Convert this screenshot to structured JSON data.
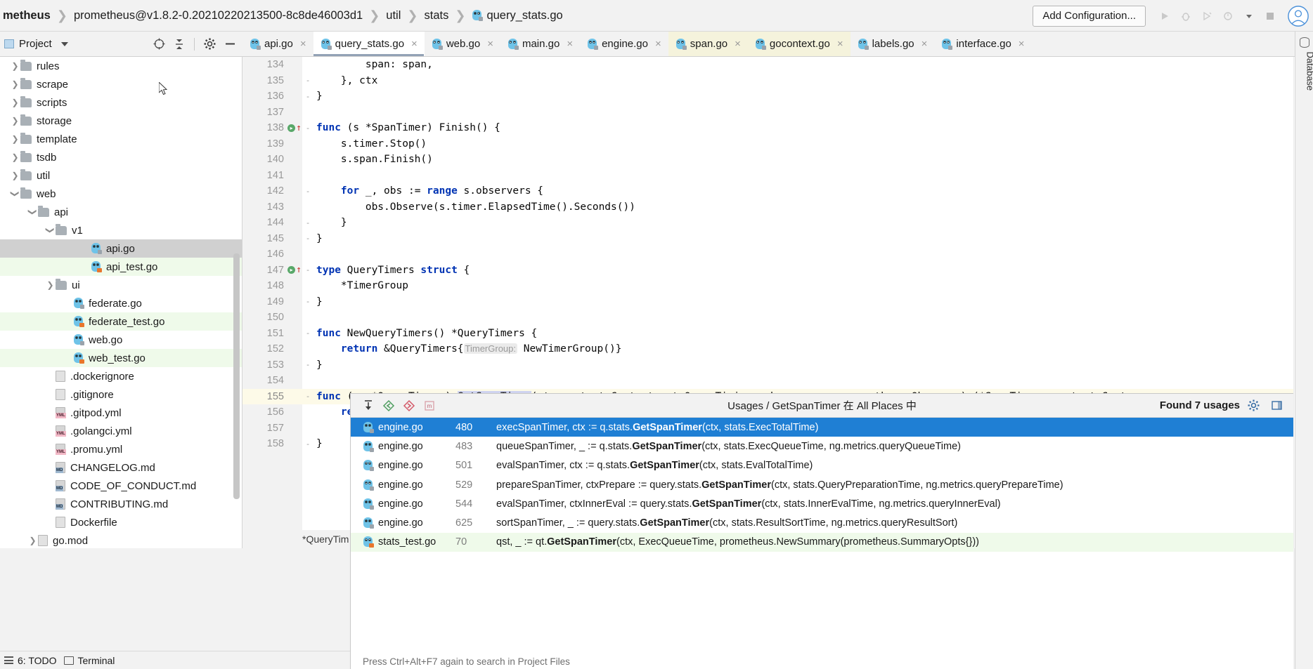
{
  "window": {
    "breadcrumbs": [
      {
        "label": "metheus",
        "bold": true,
        "icon": null
      },
      {
        "label": "prometheus@v1.8.2-0.20210220213500-8c8de46003d1",
        "bold": false,
        "icon": null
      },
      {
        "label": "util",
        "bold": false,
        "icon": null
      },
      {
        "label": "stats",
        "bold": false,
        "icon": null
      },
      {
        "label": "query_stats.go",
        "bold": false,
        "icon": "go-file-icon"
      }
    ],
    "add_configuration_label": "Add Configuration...",
    "toolbar_icons": [
      "run-icon",
      "debug-icon",
      "run-with-coverage-icon",
      "profile-icon",
      "chevron-down-icon",
      "stop-icon"
    ],
    "avatar": "user-avatar"
  },
  "project_panel": {
    "title": "Project",
    "icons": [
      "locate-icon",
      "collapse-all-icon",
      "settings-gear-icon",
      "hide-icon"
    ]
  },
  "tabs": [
    {
      "label": "api.go",
      "state": "normal",
      "icon": "go-file-icon"
    },
    {
      "label": "query_stats.go",
      "state": "active",
      "icon": "go-file-icon"
    },
    {
      "label": "web.go",
      "state": "normal",
      "icon": "go-file-icon"
    },
    {
      "label": "main.go",
      "state": "normal",
      "icon": "go-file-icon"
    },
    {
      "label": "engine.go",
      "state": "normal",
      "icon": "go-file-icon"
    },
    {
      "label": "span.go",
      "state": "modified",
      "icon": "go-file-icon"
    },
    {
      "label": "gocontext.go",
      "state": "modified",
      "icon": "go-file-icon"
    },
    {
      "label": "labels.go",
      "state": "normal",
      "icon": "go-file-icon"
    },
    {
      "label": "interface.go",
      "state": "normal",
      "icon": "go-file-icon"
    }
  ],
  "tree": [
    {
      "label": "rules",
      "indent": 1,
      "type": "folder",
      "arrow": "collapsed",
      "bg": "none"
    },
    {
      "label": "scrape",
      "indent": 1,
      "type": "folder",
      "arrow": "collapsed",
      "bg": "none"
    },
    {
      "label": "scripts",
      "indent": 1,
      "type": "folder",
      "arrow": "collapsed",
      "bg": "none"
    },
    {
      "label": "storage",
      "indent": 1,
      "type": "folder",
      "arrow": "collapsed",
      "bg": "none"
    },
    {
      "label": "template",
      "indent": 1,
      "type": "folder",
      "arrow": "collapsed",
      "bg": "none"
    },
    {
      "label": "tsdb",
      "indent": 1,
      "type": "folder",
      "arrow": "collapsed",
      "bg": "none"
    },
    {
      "label": "util",
      "indent": 1,
      "type": "folder",
      "arrow": "collapsed",
      "bg": "none"
    },
    {
      "label": "web",
      "indent": 1,
      "type": "folder",
      "arrow": "expanded",
      "bg": "none"
    },
    {
      "label": "api",
      "indent": 2,
      "type": "folder",
      "arrow": "expanded",
      "bg": "none"
    },
    {
      "label": "v1",
      "indent": 3,
      "type": "folder",
      "arrow": "expanded",
      "bg": "none"
    },
    {
      "label": "api.go",
      "indent": 5,
      "type": "go",
      "arrow": "none",
      "bg": "selected"
    },
    {
      "label": "api_test.go",
      "indent": 5,
      "type": "gotest",
      "arrow": "none",
      "bg": "green"
    },
    {
      "label": "ui",
      "indent": 3,
      "type": "folder",
      "arrow": "collapsed",
      "bg": "none"
    },
    {
      "label": "federate.go",
      "indent": 4,
      "type": "go",
      "arrow": "none",
      "bg": "none"
    },
    {
      "label": "federate_test.go",
      "indent": 4,
      "type": "gotest",
      "arrow": "none",
      "bg": "green"
    },
    {
      "label": "web.go",
      "indent": 4,
      "type": "go",
      "arrow": "none",
      "bg": "none"
    },
    {
      "label": "web_test.go",
      "indent": 4,
      "type": "gotest",
      "arrow": "none",
      "bg": "green"
    },
    {
      "label": ".dockerignore",
      "indent": 3,
      "type": "doc",
      "arrow": "none",
      "bg": "none"
    },
    {
      "label": ".gitignore",
      "indent": 3,
      "type": "doc",
      "arrow": "none",
      "bg": "none"
    },
    {
      "label": ".gitpod.yml",
      "indent": 3,
      "type": "yml",
      "arrow": "none",
      "bg": "none"
    },
    {
      "label": ".golangci.yml",
      "indent": 3,
      "type": "yml",
      "arrow": "none",
      "bg": "none"
    },
    {
      "label": ".promu.yml",
      "indent": 3,
      "type": "yml",
      "arrow": "none",
      "bg": "none"
    },
    {
      "label": "CHANGELOG.md",
      "indent": 3,
      "type": "md",
      "arrow": "none",
      "bg": "none"
    },
    {
      "label": "CODE_OF_CONDUCT.md",
      "indent": 3,
      "type": "md",
      "arrow": "none",
      "bg": "none"
    },
    {
      "label": "CONTRIBUTING.md",
      "indent": 3,
      "type": "md",
      "arrow": "none",
      "bg": "none"
    },
    {
      "label": "Dockerfile",
      "indent": 3,
      "type": "doc",
      "arrow": "none",
      "bg": "none"
    },
    {
      "label": "go.mod",
      "indent": 2,
      "type": "doc",
      "arrow": "collapsed",
      "bg": "none"
    }
  ],
  "code": {
    "file_status": "*QueryTim",
    "lines": [
      {
        "num": "134",
        "mark": "",
        "fold": "",
        "caret": false,
        "segs": [
          {
            "t": "        span: span,",
            "c": "plain"
          }
        ]
      },
      {
        "num": "135",
        "mark": "",
        "fold": "-",
        "caret": false,
        "segs": [
          {
            "t": "    }, ctx",
            "c": "plain"
          }
        ]
      },
      {
        "num": "136",
        "mark": "",
        "fold": "-",
        "caret": false,
        "segs": [
          {
            "t": "}",
            "c": "plain"
          }
        ]
      },
      {
        "num": "137",
        "mark": "",
        "fold": "",
        "caret": false,
        "segs": []
      },
      {
        "num": "138",
        "mark": "run",
        "fold": "-",
        "caret": false,
        "segs": [
          {
            "t": "func",
            "c": "kw"
          },
          {
            "t": " (s *SpanTimer) Finish() {",
            "c": "plain"
          }
        ]
      },
      {
        "num": "139",
        "mark": "",
        "fold": "",
        "caret": false,
        "segs": [
          {
            "t": "    s.timer.Stop()",
            "c": "plain"
          }
        ]
      },
      {
        "num": "140",
        "mark": "",
        "fold": "",
        "caret": false,
        "segs": [
          {
            "t": "    s.span.Finish()",
            "c": "plain"
          }
        ]
      },
      {
        "num": "141",
        "mark": "",
        "fold": "",
        "caret": false,
        "segs": []
      },
      {
        "num": "142",
        "mark": "",
        "fold": "-",
        "caret": false,
        "segs": [
          {
            "t": "    ",
            "c": "plain"
          },
          {
            "t": "for",
            "c": "kw"
          },
          {
            "t": " _, obs := ",
            "c": "plain"
          },
          {
            "t": "range",
            "c": "kw"
          },
          {
            "t": " s.observers {",
            "c": "plain"
          }
        ]
      },
      {
        "num": "143",
        "mark": "",
        "fold": "",
        "caret": false,
        "segs": [
          {
            "t": "        obs.Observe(s.timer.ElapsedTime().Seconds())",
            "c": "plain"
          }
        ]
      },
      {
        "num": "144",
        "mark": "",
        "fold": "-",
        "caret": false,
        "segs": [
          {
            "t": "    }",
            "c": "plain"
          }
        ]
      },
      {
        "num": "145",
        "mark": "",
        "fold": "-",
        "caret": false,
        "segs": [
          {
            "t": "}",
            "c": "plain"
          }
        ]
      },
      {
        "num": "146",
        "mark": "",
        "fold": "",
        "caret": false,
        "segs": []
      },
      {
        "num": "147",
        "mark": "run",
        "fold": "-",
        "caret": false,
        "segs": [
          {
            "t": "type",
            "c": "kw"
          },
          {
            "t": " QueryTimers ",
            "c": "plain"
          },
          {
            "t": "struct",
            "c": "kw"
          },
          {
            "t": " {",
            "c": "plain"
          }
        ]
      },
      {
        "num": "148",
        "mark": "",
        "fold": "",
        "caret": false,
        "segs": [
          {
            "t": "    *TimerGroup",
            "c": "plain"
          }
        ]
      },
      {
        "num": "149",
        "mark": "",
        "fold": "-",
        "caret": false,
        "segs": [
          {
            "t": "}",
            "c": "plain"
          }
        ]
      },
      {
        "num": "150",
        "mark": "",
        "fold": "",
        "caret": false,
        "segs": []
      },
      {
        "num": "151",
        "mark": "",
        "fold": "-",
        "caret": false,
        "segs": [
          {
            "t": "func",
            "c": "kw"
          },
          {
            "t": " NewQueryTimers() *QueryTimers {",
            "c": "plain"
          }
        ]
      },
      {
        "num": "152",
        "mark": "",
        "fold": "",
        "caret": false,
        "segs": [
          {
            "t": "    ",
            "c": "plain"
          },
          {
            "t": "return",
            "c": "kw"
          },
          {
            "t": " &QueryTimers{",
            "c": "plain"
          },
          {
            "t": "TimerGroup:",
            "c": "hint"
          },
          {
            "t": " NewTimerGroup()}",
            "c": "plain"
          }
        ]
      },
      {
        "num": "153",
        "mark": "",
        "fold": "-",
        "caret": false,
        "segs": [
          {
            "t": "}",
            "c": "plain"
          }
        ]
      },
      {
        "num": "154",
        "mark": "",
        "fold": "",
        "caret": false,
        "segs": []
      },
      {
        "num": "155",
        "mark": "",
        "fold": "-",
        "caret": true,
        "segs": [
          {
            "t": "func",
            "c": "kw"
          },
          {
            "t": " (qs *QueryTimers) ",
            "c": "plain"
          },
          {
            "t": "GetSpanTimer",
            "c": "selref"
          },
          {
            "t": "(ctx context.Context, qt QueryTiming, observers ...prometheus.Observer) (*SpanTimer, context.Conte",
            "c": "plain"
          }
        ]
      },
      {
        "num": "156",
        "mark": "",
        "fold": "",
        "caret": false,
        "segs": [
          {
            "t": "    retur",
            "c": "kw"
          }
        ]
      },
      {
        "num": "157",
        "mark": "",
        "fold": "",
        "caret": false,
        "segs": []
      },
      {
        "num": "158",
        "mark": "",
        "fold": "-",
        "caret": false,
        "segs": [
          {
            "t": "}",
            "c": "plain"
          }
        ]
      }
    ]
  },
  "usages": {
    "title": "Usages / GetSpanTimer 在 All Places 中",
    "found_label": "Found 7 usages",
    "toolbar_icons": [
      "expand-all-icon",
      "previous-occurrence-icon",
      "next-occurrence-icon",
      "show-read-write-icon"
    ],
    "right_icons": [
      "settings-gear-icon",
      "hide-panel-icon"
    ],
    "footer_hint": "Press Ctrl+Alt+F7 again to search in Project Files",
    "rows": [
      {
        "file": "engine.go",
        "icon": "go-file-icon",
        "line": "480",
        "pre": "execSpanTimer, ctx := q.stats.",
        "match": "GetSpanTimer",
        "post": "(ctx, stats.ExecTotalTime)",
        "state": "selected"
      },
      {
        "file": "engine.go",
        "icon": "go-file-icon",
        "line": "483",
        "pre": "queueSpanTimer, _ := q.stats.",
        "match": "GetSpanTimer",
        "post": "(ctx, stats.ExecQueueTime, ng.metrics.queryQueueTime)",
        "state": "normal"
      },
      {
        "file": "engine.go",
        "icon": "go-file-icon",
        "line": "501",
        "pre": "evalSpanTimer, ctx := q.stats.",
        "match": "GetSpanTimer",
        "post": "(ctx, stats.EvalTotalTime)",
        "state": "normal"
      },
      {
        "file": "engine.go",
        "icon": "go-file-icon",
        "line": "529",
        "pre": "prepareSpanTimer, ctxPrepare := query.stats.",
        "match": "GetSpanTimer",
        "post": "(ctx, stats.QueryPreparationTime, ng.metrics.queryPrepareTime)",
        "state": "normal"
      },
      {
        "file": "engine.go",
        "icon": "go-file-icon",
        "line": "544",
        "pre": "evalSpanTimer, ctxInnerEval := query.stats.",
        "match": "GetSpanTimer",
        "post": "(ctx, stats.InnerEvalTime, ng.metrics.queryInnerEval)",
        "state": "normal"
      },
      {
        "file": "engine.go",
        "icon": "go-file-icon",
        "line": "625",
        "pre": "sortSpanTimer, _ := query.stats.",
        "match": "GetSpanTimer",
        "post": "(ctx, stats.ResultSortTime, ng.metrics.queryResultSort)",
        "state": "normal"
      },
      {
        "file": "stats_test.go",
        "icon": "go-test-file-icon",
        "line": "70",
        "pre": "qst, _ := qt.",
        "match": "GetSpanTimer",
        "post": "(ctx, ExecQueueTime, prometheus.NewSummary(prometheus.SummaryOpts{}))",
        "state": "green"
      }
    ]
  },
  "right_strip": {
    "label": "Database",
    "icon": "database-icon"
  },
  "status_bar": {
    "items": [
      {
        "label": "6: TODO",
        "icon": "todo-icon"
      },
      {
        "label": "Terminal",
        "icon": "terminal-icon"
      }
    ]
  },
  "colors": {
    "selection_blue": "#1f7fd4",
    "tree_selected": "#d0d0d0",
    "test_green": "#effaea",
    "modified_tab": "#f5f3dc",
    "caret_line": "#fdfae8",
    "keyword_blue": "#0033b3",
    "reference_highlight": "#cfd3f0",
    "gopher_blue": "#6fc3e8"
  }
}
